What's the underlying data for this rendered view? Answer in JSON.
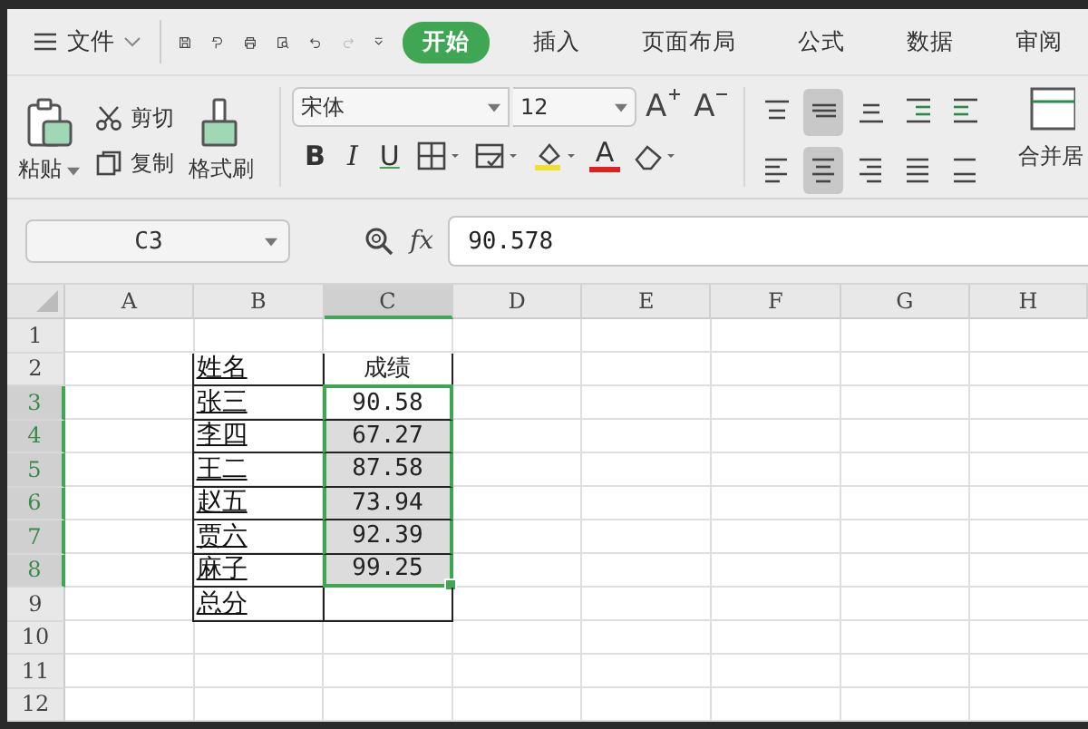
{
  "menu": {
    "file": "文件",
    "tabs": [
      {
        "label": "开始",
        "selected": true
      },
      {
        "label": "插入",
        "selected": false
      },
      {
        "label": "页面布局",
        "selected": false
      },
      {
        "label": "公式",
        "selected": false
      },
      {
        "label": "数据",
        "selected": false
      },
      {
        "label": "审阅",
        "selected": false
      }
    ],
    "redo_disabled": true
  },
  "ribbon": {
    "paste": "粘贴",
    "cut": "剪切",
    "copy": "复制",
    "format_painter": "格式刷",
    "font_name": "宋体",
    "font_size": "12",
    "grow_font": "A",
    "shrink_font": "A",
    "bold": "B",
    "italic": "I",
    "underline": "U",
    "font_color": "A",
    "align_buttons": [
      {
        "kind": "top",
        "selected": false
      },
      {
        "kind": "middle",
        "selected": true
      },
      {
        "kind": "bottom",
        "selected": false
      },
      {
        "kind": "outdent",
        "selected": false
      },
      {
        "kind": "indent",
        "selected": false
      },
      {
        "kind": "left",
        "selected": false
      },
      {
        "kind": "center",
        "selected": true
      },
      {
        "kind": "right",
        "selected": false
      },
      {
        "kind": "justify",
        "selected": false
      },
      {
        "kind": "distribute",
        "selected": false
      }
    ],
    "merge": "合并居"
  },
  "formula_bar": {
    "name_box": "C3",
    "fx": "fx",
    "value": "90.578"
  },
  "sheet": {
    "columns": [
      {
        "label": "A",
        "selected": false
      },
      {
        "label": "B",
        "selected": false
      },
      {
        "label": "C",
        "selected": true
      },
      {
        "label": "D",
        "selected": false
      },
      {
        "label": "E",
        "selected": false
      },
      {
        "label": "F",
        "selected": false
      },
      {
        "label": "G",
        "selected": false
      },
      {
        "label": "H",
        "selected": false
      }
    ],
    "rows": [
      {
        "label": "1",
        "selected": false,
        "active": false,
        "bordered": false
      },
      {
        "label": "2",
        "selected": false,
        "active": false,
        "bordered": true,
        "name": "姓名",
        "score": "成绩"
      },
      {
        "label": "3",
        "selected": true,
        "active": true,
        "bordered": true,
        "name": "张三",
        "score": "90.58"
      },
      {
        "label": "4",
        "selected": true,
        "active": false,
        "bordered": true,
        "name": "李四",
        "score": "67.27"
      },
      {
        "label": "5",
        "selected": true,
        "active": false,
        "bordered": true,
        "name": "王二",
        "score": "87.58"
      },
      {
        "label": "6",
        "selected": true,
        "active": false,
        "bordered": true,
        "name": "赵五",
        "score": "73.94"
      },
      {
        "label": "7",
        "selected": true,
        "active": false,
        "bordered": true,
        "name": "贾六",
        "score": "92.39"
      },
      {
        "label": "8",
        "selected": true,
        "active": false,
        "bordered": true,
        "name": "麻子",
        "score": "99.25"
      },
      {
        "label": "9",
        "selected": false,
        "active": false,
        "bordered": true,
        "name": "总分"
      },
      {
        "label": "10",
        "selected": false,
        "active": false,
        "bordered": false
      },
      {
        "label": "11",
        "selected": false,
        "active": false,
        "bordered": false
      },
      {
        "label": "12",
        "selected": false,
        "active": false,
        "bordered": false
      }
    ]
  }
}
